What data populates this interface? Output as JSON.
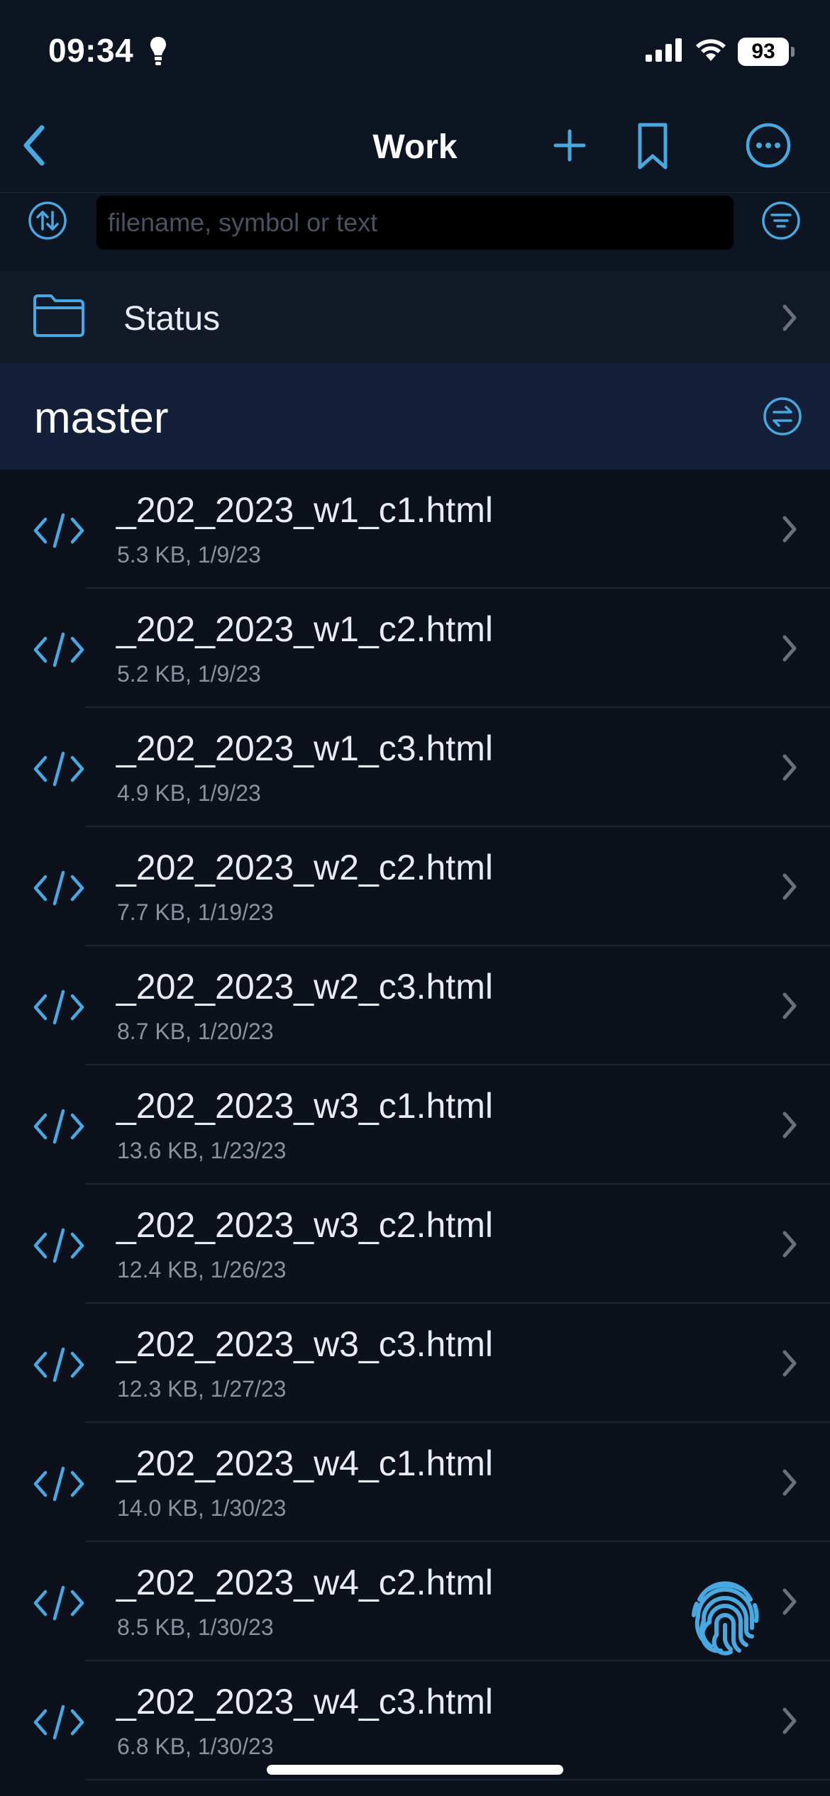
{
  "status_bar": {
    "time": "09:34",
    "battery": "93"
  },
  "nav": {
    "title": "Work"
  },
  "search": {
    "placeholder": "filename, symbol or text"
  },
  "status_item": {
    "label": "Status"
  },
  "branch": {
    "name": "master"
  },
  "files": [
    {
      "name": "_202_2023_w1_c1.html",
      "meta": "5.3 KB, 1/9/23"
    },
    {
      "name": "_202_2023_w1_c2.html",
      "meta": "5.2 KB, 1/9/23"
    },
    {
      "name": "_202_2023_w1_c3.html",
      "meta": "4.9 KB, 1/9/23"
    },
    {
      "name": "_202_2023_w2_c2.html",
      "meta": "7.7 KB, 1/19/23"
    },
    {
      "name": "_202_2023_w2_c3.html",
      "meta": "8.7 KB, 1/20/23"
    },
    {
      "name": "_202_2023_w3_c1.html",
      "meta": "13.6 KB, 1/23/23"
    },
    {
      "name": "_202_2023_w3_c2.html",
      "meta": "12.4 KB, 1/26/23"
    },
    {
      "name": "_202_2023_w3_c3.html",
      "meta": "12.3 KB, 1/27/23"
    },
    {
      "name": "_202_2023_w4_c1.html",
      "meta": "14.0 KB, 1/30/23"
    },
    {
      "name": "_202_2023_w4_c2.html",
      "meta": "8.5 KB, 1/30/23"
    },
    {
      "name": "_202_2023_w4_c3.html",
      "meta": "6.8 KB, 1/30/23"
    }
  ],
  "colors": {
    "accent": "#4aa8e0",
    "background": "#0c111b",
    "branch_header": "#14203a"
  },
  "icons": {
    "back": "chevron-left-icon",
    "add": "plus-icon",
    "bookmark": "bookmark-icon",
    "more": "ellipsis-circle-icon",
    "sort": "sort-arrows-icon",
    "filter": "filter-icon",
    "folder": "folder-icon",
    "branch_switch": "switch-arrows-icon",
    "file": "code-file-icon",
    "fingerprint": "fingerprint-icon"
  }
}
